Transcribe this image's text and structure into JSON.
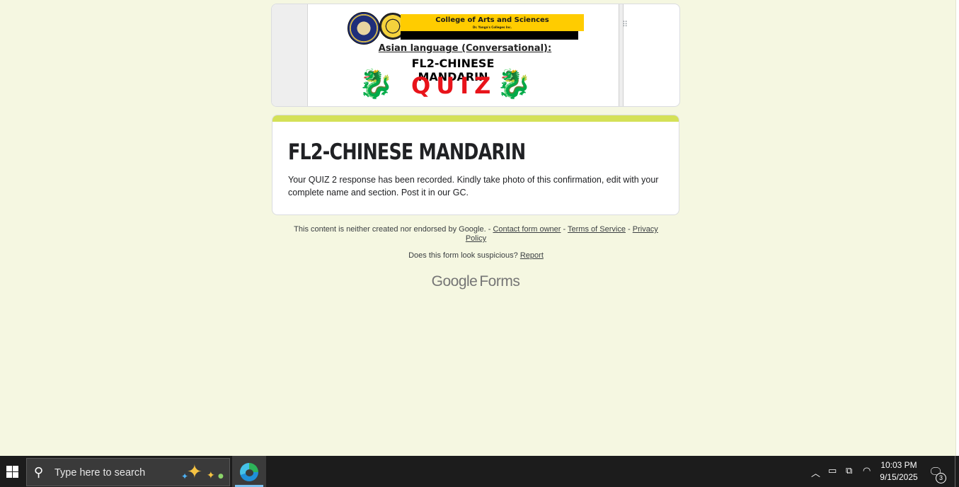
{
  "banner": {
    "college_title": "College of Arts and Sciences",
    "college_subtitle": "Dr. Yanga's Colleges Inc.",
    "course_heading": "Asian language (Conversational):",
    "course_name": "FL2-CHINESE MANDARIN",
    "quiz_word": "QUIZ",
    "drag_handle": "⠿",
    "dragon_glyph": "🐉"
  },
  "confirmation": {
    "title": "FL2-CHINESE MANDARIN",
    "message": "Your QUIZ 2 response has been recorded. Kindly take photo of this confirmation, edit with your complete name and section. Post it in our GC.",
    "accent_color": "#d4e157"
  },
  "footer": {
    "disclaimer": "This content is neither created nor endorsed by Google. -",
    "contact_link": "Contact form owner",
    "sep1": "-",
    "terms_link": "Terms of Service",
    "sep2": "-",
    "privacy_link": "Privacy Policy",
    "suspicious_text": "Does this form look suspicious?",
    "report_link": "Report",
    "logo_google": "Google",
    "logo_forms": "Forms"
  },
  "taskbar": {
    "search_placeholder": "Type here to search",
    "time": "10:03 PM",
    "date": "9/15/2025",
    "notification_count": "3",
    "icons": {
      "start": "windows-logo",
      "search": "search-icon",
      "edge": "edge-browser-icon",
      "chevron": "^",
      "battery": "▭",
      "display": "⧉",
      "wifi": "◠",
      "notifications": "🗨"
    }
  }
}
